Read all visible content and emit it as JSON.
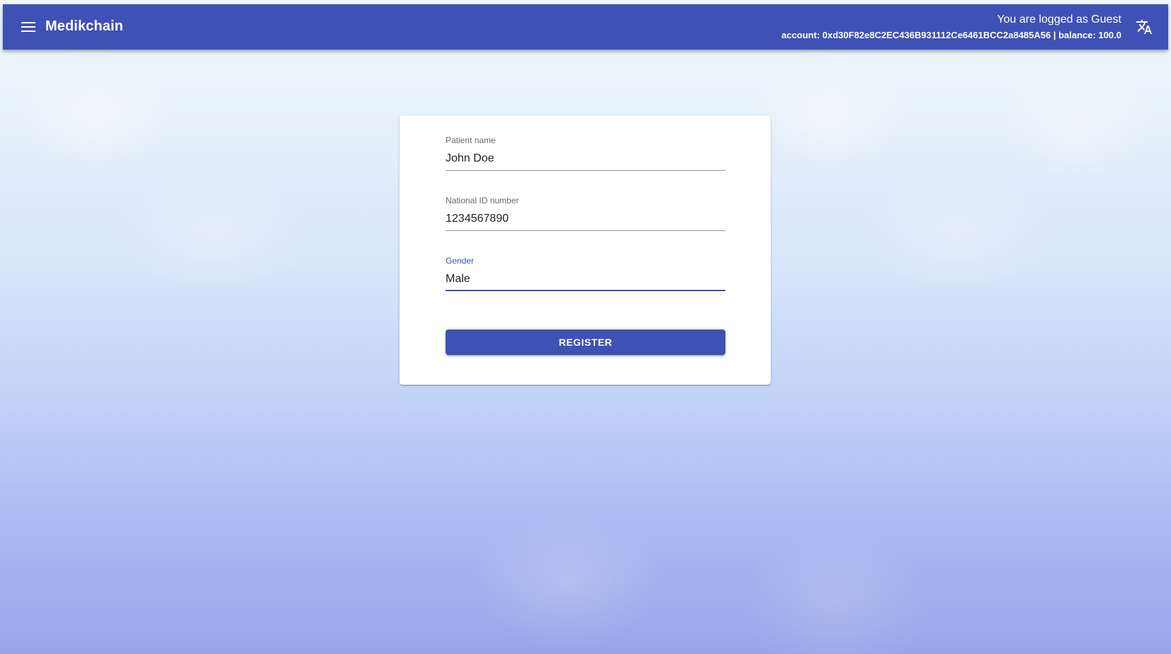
{
  "header": {
    "app_title": "Medikchain",
    "logged_as": "You are logged as Guest",
    "account_line": "account: 0xd30F82e8C2EC436B931112Ce6461BCC2a8485A56 | balance: 100.0",
    "menu_icon": "menu-icon",
    "translate_icon": "translate-icon",
    "bg_color": "#3f51b5"
  },
  "form": {
    "patient_name": {
      "label": "Patient name",
      "value": "John Doe"
    },
    "national_id": {
      "label": "National ID number",
      "value": "1234567890"
    },
    "gender": {
      "label": "Gender",
      "value": "Male"
    },
    "register_label": "REGISTER",
    "accent_color": "#3f51b5"
  }
}
